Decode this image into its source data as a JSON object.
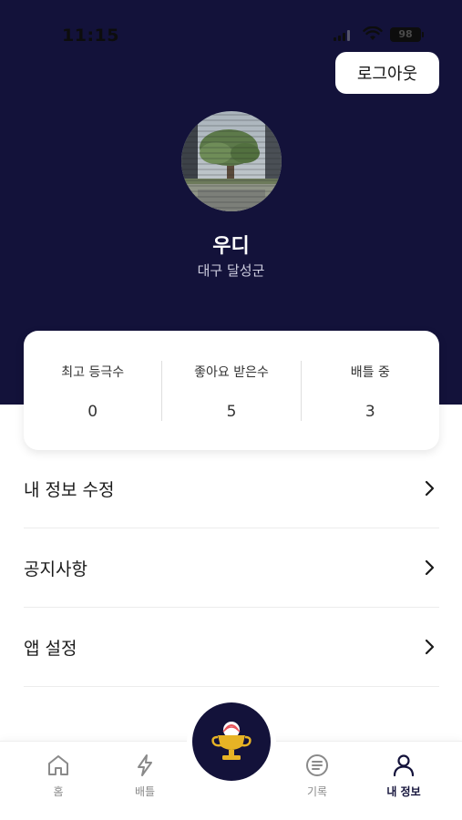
{
  "status_bar": {
    "time": "11:15",
    "battery": "98"
  },
  "header": {
    "logout_label": "로그아웃"
  },
  "profile": {
    "name": "우디",
    "location": "대구 달성군"
  },
  "stats": [
    {
      "label": "최고 등극수",
      "value": "0"
    },
    {
      "label": "좋아요 받은수",
      "value": "5"
    },
    {
      "label": "배틀 중",
      "value": "3"
    }
  ],
  "menu": [
    {
      "label": "내 정보 수정"
    },
    {
      "label": "공지사항"
    },
    {
      "label": "앱 설정"
    }
  ],
  "tabs": [
    {
      "label": "홈",
      "icon": "home-icon"
    },
    {
      "label": "배틀",
      "icon": "lightning-icon"
    },
    {
      "label": "기록",
      "icon": "list-icon"
    },
    {
      "label": "내 정보",
      "icon": "person-icon"
    }
  ],
  "center_button": {
    "icon": "trophy-icon"
  },
  "colors": {
    "primary": "#13123a",
    "trophy": "#e7b325",
    "inactive": "#8a8a8a"
  }
}
